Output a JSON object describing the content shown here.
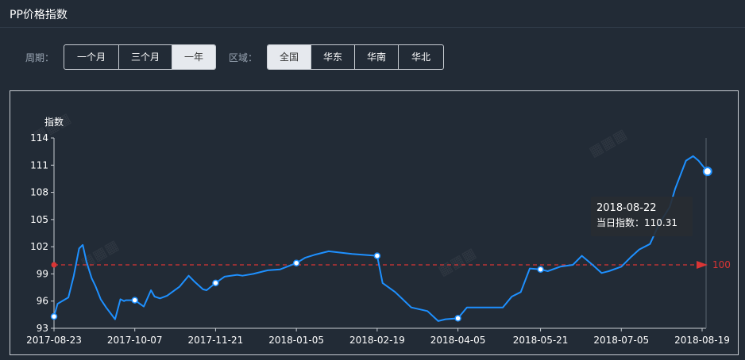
{
  "header": {
    "title": "PP价格指数"
  },
  "filters": {
    "period_label": "周期：",
    "period_options": [
      "一个月",
      "三个月",
      "一年"
    ],
    "period_selected": "一年",
    "region_label": "区域：",
    "region_options": [
      "全国",
      "华东",
      "华南",
      "华北"
    ],
    "region_selected": "全国"
  },
  "tooltip": {
    "date": "2018-08-22",
    "value_label": "当日指数：110.31"
  },
  "colors": {
    "line": "#1e90ff",
    "baseline": "#d93535",
    "background": "#222b36"
  },
  "chart_data": {
    "type": "line",
    "ylabel": "指数",
    "ylim": [
      93,
      114
    ],
    "yticks": [
      93,
      96,
      99,
      102,
      105,
      108,
      111,
      114
    ],
    "xticks": [
      "2017-08-23",
      "2017-10-07",
      "2017-11-21",
      "2018-01-05",
      "2018-02-19",
      "2018-04-05",
      "2018-05-21",
      "2018-07-05",
      "2018-08-19"
    ],
    "baseline": {
      "value": 100,
      "label": "100"
    },
    "series": [
      {
        "x": [
          "2017-08-23",
          "2017-08-25",
          "2017-08-31",
          "2017-09-03",
          "2017-09-06",
          "2017-09-08",
          "2017-09-10",
          "2017-09-13",
          "2017-09-15",
          "2017-09-18",
          "2017-09-21",
          "2017-09-26",
          "2017-09-29",
          "2017-10-01",
          "2017-10-02",
          "2017-10-04",
          "2017-10-07",
          "2017-10-12",
          "2017-10-16",
          "2017-10-18",
          "2017-10-21",
          "2017-10-25",
          "2017-11-01",
          "2017-11-06",
          "2017-11-09",
          "2017-11-14",
          "2017-11-16",
          "2017-11-21",
          "2017-11-26",
          "2017-12-03",
          "2017-12-06",
          "2017-12-12",
          "2017-12-20",
          "2017-12-27",
          "2018-01-05",
          "2018-01-10",
          "2018-01-15",
          "2018-01-23",
          "2018-02-05",
          "2018-02-19",
          "2018-02-22",
          "2018-03-01",
          "2018-03-10",
          "2018-03-19",
          "2018-03-25",
          "2018-03-29",
          "2018-04-05",
          "2018-04-10",
          "2018-04-20",
          "2018-04-30",
          "2018-05-05",
          "2018-05-10",
          "2018-05-15",
          "2018-05-21",
          "2018-05-25",
          "2018-06-01",
          "2018-06-08",
          "2018-06-13",
          "2018-06-19",
          "2018-06-24",
          "2018-06-28",
          "2018-07-05",
          "2018-07-10",
          "2018-07-15",
          "2018-07-21",
          "2018-07-26",
          "2018-08-01",
          "2018-08-04",
          "2018-08-10",
          "2018-08-14",
          "2018-08-17",
          "2018-08-19",
          "2018-08-22"
        ],
        "y": [
          94.3,
          95.7,
          96.4,
          98.8,
          101.8,
          102.2,
          100.4,
          98.5,
          97.7,
          96.2,
          95.3,
          94.0,
          96.2,
          96.0,
          96.1,
          96.1,
          96.1,
          95.4,
          97.2,
          96.5,
          96.3,
          96.6,
          97.6,
          98.8,
          98.2,
          97.3,
          97.2,
          98.0,
          98.7,
          98.9,
          98.8,
          99.0,
          99.4,
          99.5,
          100.2,
          100.8,
          101.1,
          101.5,
          101.2,
          101.0,
          98.0,
          97.0,
          95.3,
          94.9,
          93.8,
          94.0,
          94.1,
          95.3,
          95.3,
          95.3,
          96.5,
          97.0,
          99.6,
          99.5,
          99.3,
          99.8,
          100.0,
          101.0,
          100.0,
          99.1,
          99.3,
          99.8,
          100.8,
          101.7,
          102.3,
          104.5,
          106.4,
          108.4,
          111.5,
          112.0,
          111.5,
          111.0,
          110.31
        ]
      }
    ],
    "markers": [
      {
        "x": "2017-08-23",
        "y": 94.3
      },
      {
        "x": "2017-10-07",
        "y": 96.1
      },
      {
        "x": "2017-11-21",
        "y": 98.0
      },
      {
        "x": "2018-01-05",
        "y": 100.2
      },
      {
        "x": "2018-02-19",
        "y": 101.0
      },
      {
        "x": "2018-04-05",
        "y": 94.1
      },
      {
        "x": "2018-05-21",
        "y": 99.5
      },
      {
        "x": "2018-08-22",
        "y": 110.31
      }
    ]
  }
}
